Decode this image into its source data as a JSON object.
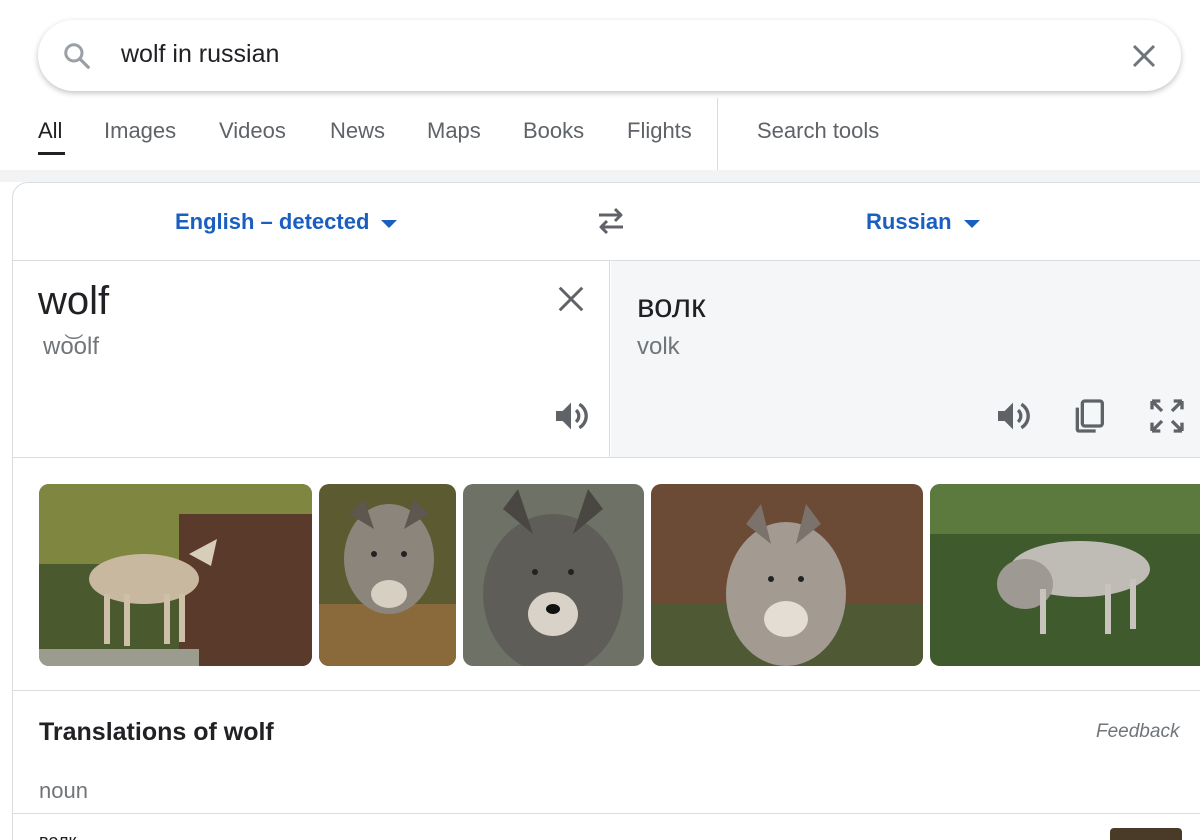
{
  "search": {
    "query": "wolf in russian"
  },
  "tabs": [
    {
      "label": "All",
      "active": true
    },
    {
      "label": "Images"
    },
    {
      "label": "Videos"
    },
    {
      "label": "News"
    },
    {
      "label": "Maps"
    },
    {
      "label": "Books"
    },
    {
      "label": "Flights"
    },
    {
      "label": "Search tools"
    }
  ],
  "translator": {
    "source_language": "English – detected",
    "target_language": "Russian",
    "source_text": "wolf",
    "source_phonetic": "wo͝olf",
    "target_text": "волк",
    "target_romanization": "volk"
  },
  "images": [
    {
      "alt_name": "wolf-standing-on-rock-image"
    },
    {
      "alt_name": "wolf-face-closeup-image"
    },
    {
      "alt_name": "gray-wolf-portrait-image"
    },
    {
      "alt_name": "wolf-in-forest-image"
    },
    {
      "alt_name": "wolf-in-grass-image"
    }
  ],
  "translations": {
    "title": "Translations of wolf",
    "feedback_label": "Feedback",
    "part_of_speech": "noun",
    "first_entry_peek": "волк"
  },
  "colors": {
    "link_blue": "#1a5fc0",
    "text_primary": "#202124",
    "text_secondary": "#70757a",
    "icon_gray": "#5f6368"
  }
}
